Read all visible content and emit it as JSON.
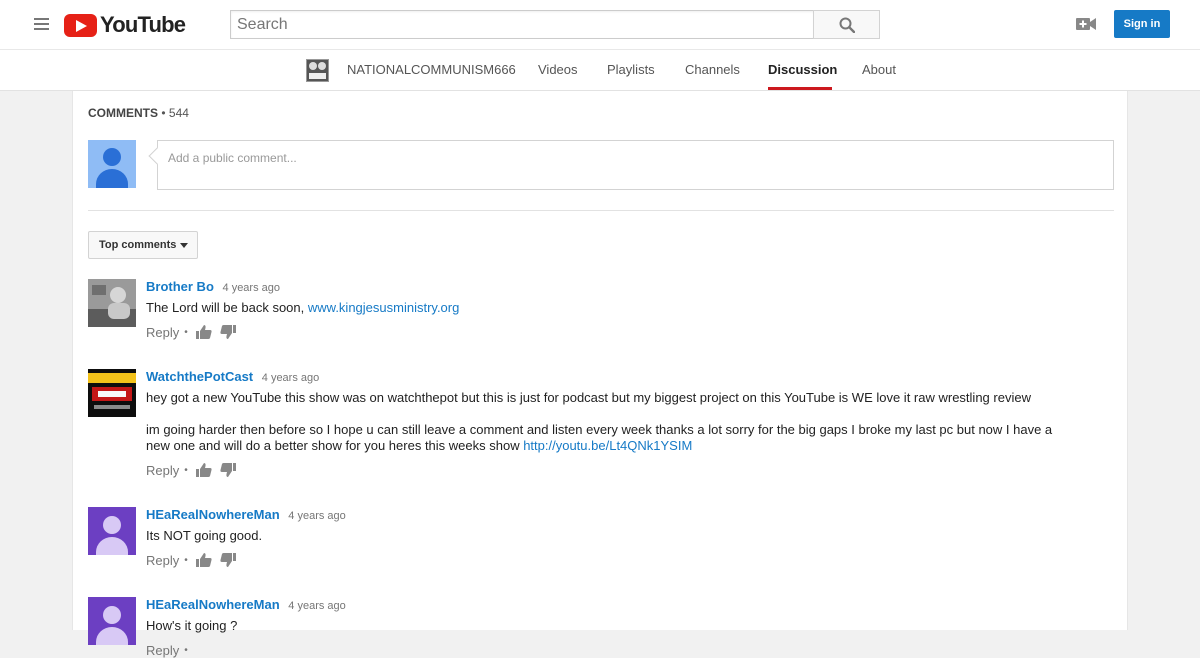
{
  "masthead": {
    "logo_text": "YouTube",
    "search_placeholder": "Search",
    "signin_label": "Sign in"
  },
  "channel_nav": {
    "channel_name": "NATIONALCOMMUNISM666",
    "tabs": [
      "Videos",
      "Playlists",
      "Channels",
      "Discussion",
      "About"
    ],
    "active_tab": "Discussion"
  },
  "comments_section": {
    "label": "Comments",
    "separator": "•",
    "count": "544",
    "input_placeholder": "Add a public comment...",
    "sort_label": "Top comments"
  },
  "comments": [
    {
      "author": "Brother Bo",
      "time": "4 years ago",
      "text_before_link": "The Lord will be back soon, ",
      "link": "www.kingjesusministry.org",
      "reply_label": "Reply"
    },
    {
      "author": "WatchthePotCast",
      "time": "4 years ago",
      "paragraph1": "hey got a new YouTube this show was on watchthepot but this is  just for podcast but my biggest project on this YouTube  is WE love it raw wrestling review",
      "paragraph2_before_link": "im  going harder then before so I hope u can still leave a comment and listen every week thanks a lot    sorry for the big gaps I broke my last pc but now I have a new one and will do a better show for you    heres this weeks show ",
      "link": "http://youtu.be/Lt4QNk1YSIM",
      "reply_label": "Reply"
    },
    {
      "author": "HEaRealNowhereMan",
      "time": "4 years ago",
      "text": "Its NOT going good.",
      "reply_label": "Reply"
    },
    {
      "author": "HEaRealNowhereMan",
      "time": "4 years ago",
      "text": "How's it going ?",
      "reply_label": "Reply"
    }
  ],
  "colors": {
    "brand_red": "#e62117",
    "link_blue": "#167ac6",
    "active_underline": "#cc181e",
    "avatar_purple": "#6c3fc2"
  },
  "icons": [
    "hamburger-menu-icon",
    "search-icon",
    "upload-video-icon",
    "thumbs-up-icon",
    "thumbs-down-icon",
    "caret-down-icon"
  ]
}
